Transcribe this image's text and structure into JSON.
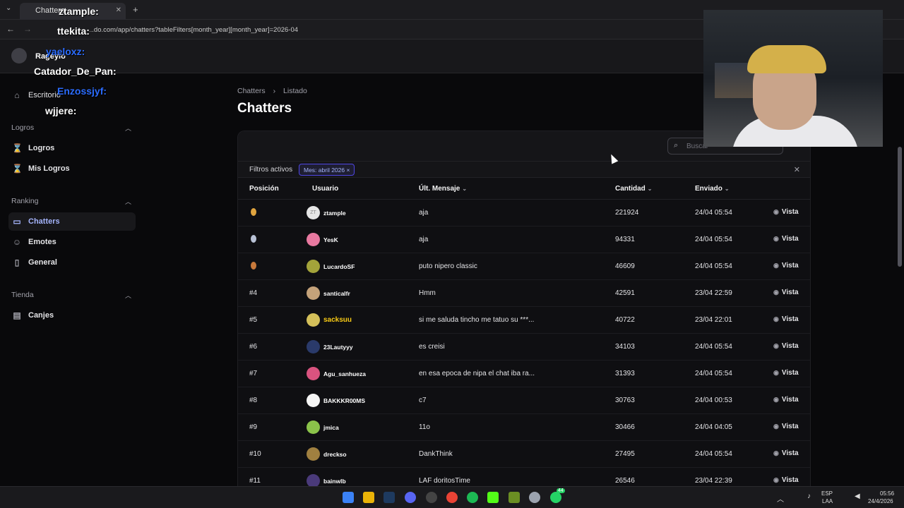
{
  "browser": {
    "tab_title": "Chatters",
    "url": "...do.com/app/chatters?tableFilters[month_year][month_year]=2026-04"
  },
  "header": {
    "username": "Rageyio"
  },
  "sidebar": {
    "top_item": "Escritorio",
    "groups": [
      {
        "title": "Logros",
        "items": [
          "Logros",
          "Mis Logros"
        ]
      },
      {
        "title": "Ranking",
        "items": [
          "Chatters",
          "Emotes",
          "General"
        ]
      },
      {
        "title": "Tienda",
        "items": [
          "Canjes"
        ]
      }
    ]
  },
  "breadcrumb": [
    "Chatters",
    "Listado"
  ],
  "page_title": "Chatters",
  "search": {
    "placeholder": "Buscar"
  },
  "filters": {
    "label": "Filtros activos",
    "chip": "Mes: abril 2026"
  },
  "columns": {
    "position": "Posición",
    "user": "Usuario",
    "last_message": "Últ. Mensaje",
    "count": "Cantidad",
    "sent": "Enviado"
  },
  "view_label": "Vista",
  "rows": [
    {
      "pos": "",
      "medal": "#e0a43f",
      "user": "ztample",
      "avatar": "ZT",
      "msg": "aja",
      "count": "221924",
      "sent": "24/04 05:54"
    },
    {
      "pos": "",
      "medal": "#b9c2d6",
      "user": "YesK",
      "avatar": "",
      "msg": "aja",
      "count": "94331",
      "sent": "24/04 05:54"
    },
    {
      "pos": "",
      "medal": "#c8793b",
      "user": "LucardoSF",
      "avatar": "",
      "msg": "puto nipero classic",
      "count": "46609",
      "sent": "24/04 05:54"
    },
    {
      "pos": "#4",
      "user": "santicalfr",
      "avatar": "",
      "msg": "Hmm",
      "count": "42591",
      "sent": "23/04 22:59"
    },
    {
      "pos": "#5",
      "user": "sacksuu",
      "avatar": "",
      "msg": "si me saluda tincho me tatuo su ***...",
      "count": "40722",
      "sent": "23/04 22:01",
      "highlight": true
    },
    {
      "pos": "#6",
      "user": "23Lautyyy",
      "avatar": "",
      "msg": "es creisi",
      "count": "34103",
      "sent": "24/04 05:54"
    },
    {
      "pos": "#7",
      "user": "Agu_sanhueza",
      "avatar": "",
      "msg": "en esa epoca de nipa el chat iba ra...",
      "count": "31393",
      "sent": "24/04 05:54"
    },
    {
      "pos": "#8",
      "user": "BAKKKR00MS",
      "avatar": "",
      "msg": "c7",
      "count": "30763",
      "sent": "24/04 00:53"
    },
    {
      "pos": "#9",
      "user": "jmica",
      "avatar": "",
      "msg": "11o",
      "count": "30466",
      "sent": "24/04 04:05"
    },
    {
      "pos": "#10",
      "user": "drecksо",
      "avatar": "",
      "msg": "DankThink",
      "count": "27495",
      "sent": "24/04 05:54"
    },
    {
      "pos": "#11",
      "user": "bainwlb",
      "avatar": "",
      "msg": "LAF doritosTime",
      "count": "26546",
      "sent": "23/04 22:39"
    }
  ],
  "chat_overlay": [
    {
      "user": "ztample:",
      "color": "#ffffff"
    },
    {
      "user": "ttekita:",
      "color": "#ffffff"
    },
    {
      "user": "yaeloxz:",
      "color": "#2b6cff"
    },
    {
      "user": "Catador_De_Pan:",
      "color": "#ffffff"
    },
    {
      "user": "Enzossjyf:",
      "color": "#2b6cff"
    },
    {
      "user": "wjjere:",
      "color": "#ffffff"
    }
  ],
  "taskbar": {
    "lang_top": "ESP",
    "lang_bottom": "LAA",
    "time": "05:56",
    "date": "24/4/2026",
    "whatsapp_badge": "44"
  }
}
